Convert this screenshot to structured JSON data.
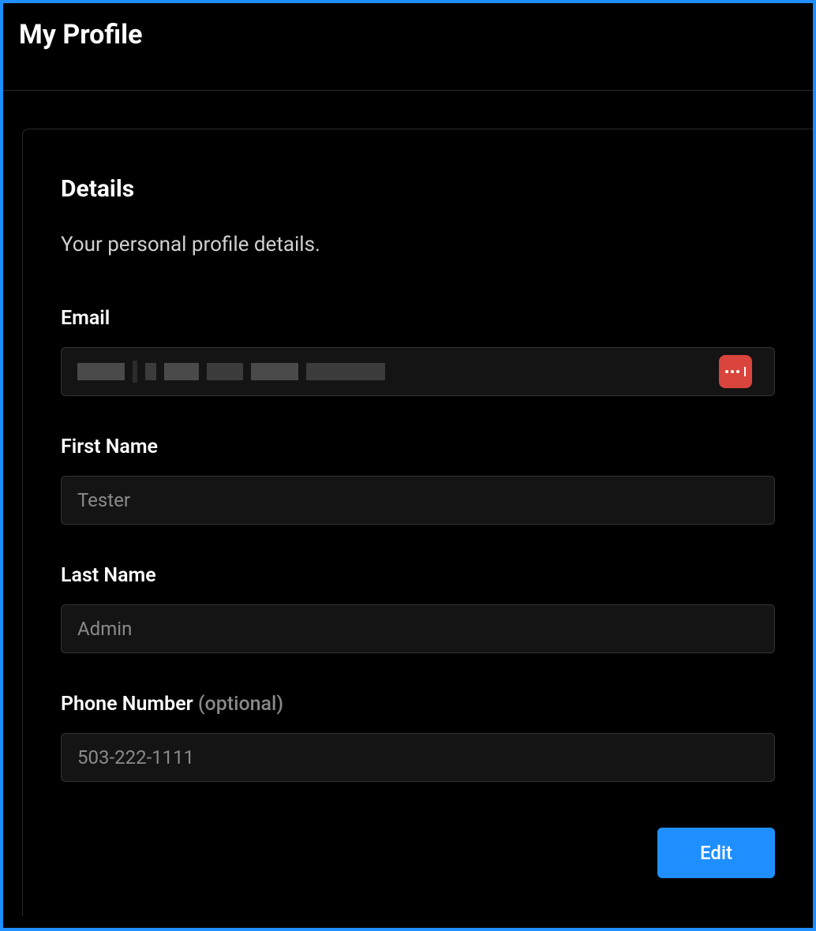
{
  "header": {
    "title": "My Profile"
  },
  "details": {
    "title": "Details",
    "subtitle": "Your personal profile details.",
    "fields": {
      "email": {
        "label": "Email",
        "value": ""
      },
      "first_name": {
        "label": "First Name",
        "value": "Tester"
      },
      "last_name": {
        "label": "Last Name",
        "value": "Admin"
      },
      "phone": {
        "label": "Phone Number",
        "optional_text": "(optional)",
        "value": "503-222-1111"
      }
    },
    "pm_icon": "password-manager-icon",
    "edit_button": "Edit"
  }
}
